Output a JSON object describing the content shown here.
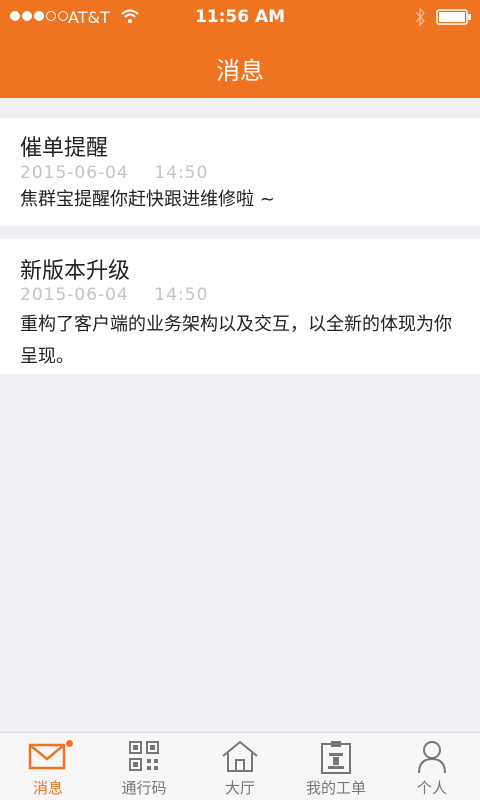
{
  "status_bar": {
    "carrier": "AT&T",
    "time": "11:56 AM"
  },
  "header": {
    "title": "消息"
  },
  "messages": [
    {
      "title": "催单提醒",
      "timestamp": "2015-06-04    14:50",
      "body": "焦群宝提醒你赶快跟进维修啦 ~"
    },
    {
      "title": "新版本升级",
      "timestamp": "2015-06-04    14:50",
      "body": "重构了客户端的业务架构以及交互，以全新的体现为你呈现。"
    }
  ],
  "tabbar": {
    "tabs": [
      {
        "label": "消息",
        "icon": "mail-icon",
        "active": true
      },
      {
        "label": "通行码",
        "icon": "qr-code-icon"
      },
      {
        "label": "大厅",
        "icon": "house-icon"
      },
      {
        "label": "我的工单",
        "icon": "clipboard-icon"
      },
      {
        "label": "个人",
        "icon": "user-icon"
      }
    ]
  },
  "colors": {
    "accent": "#ef7422",
    "background": "#efeff4"
  }
}
